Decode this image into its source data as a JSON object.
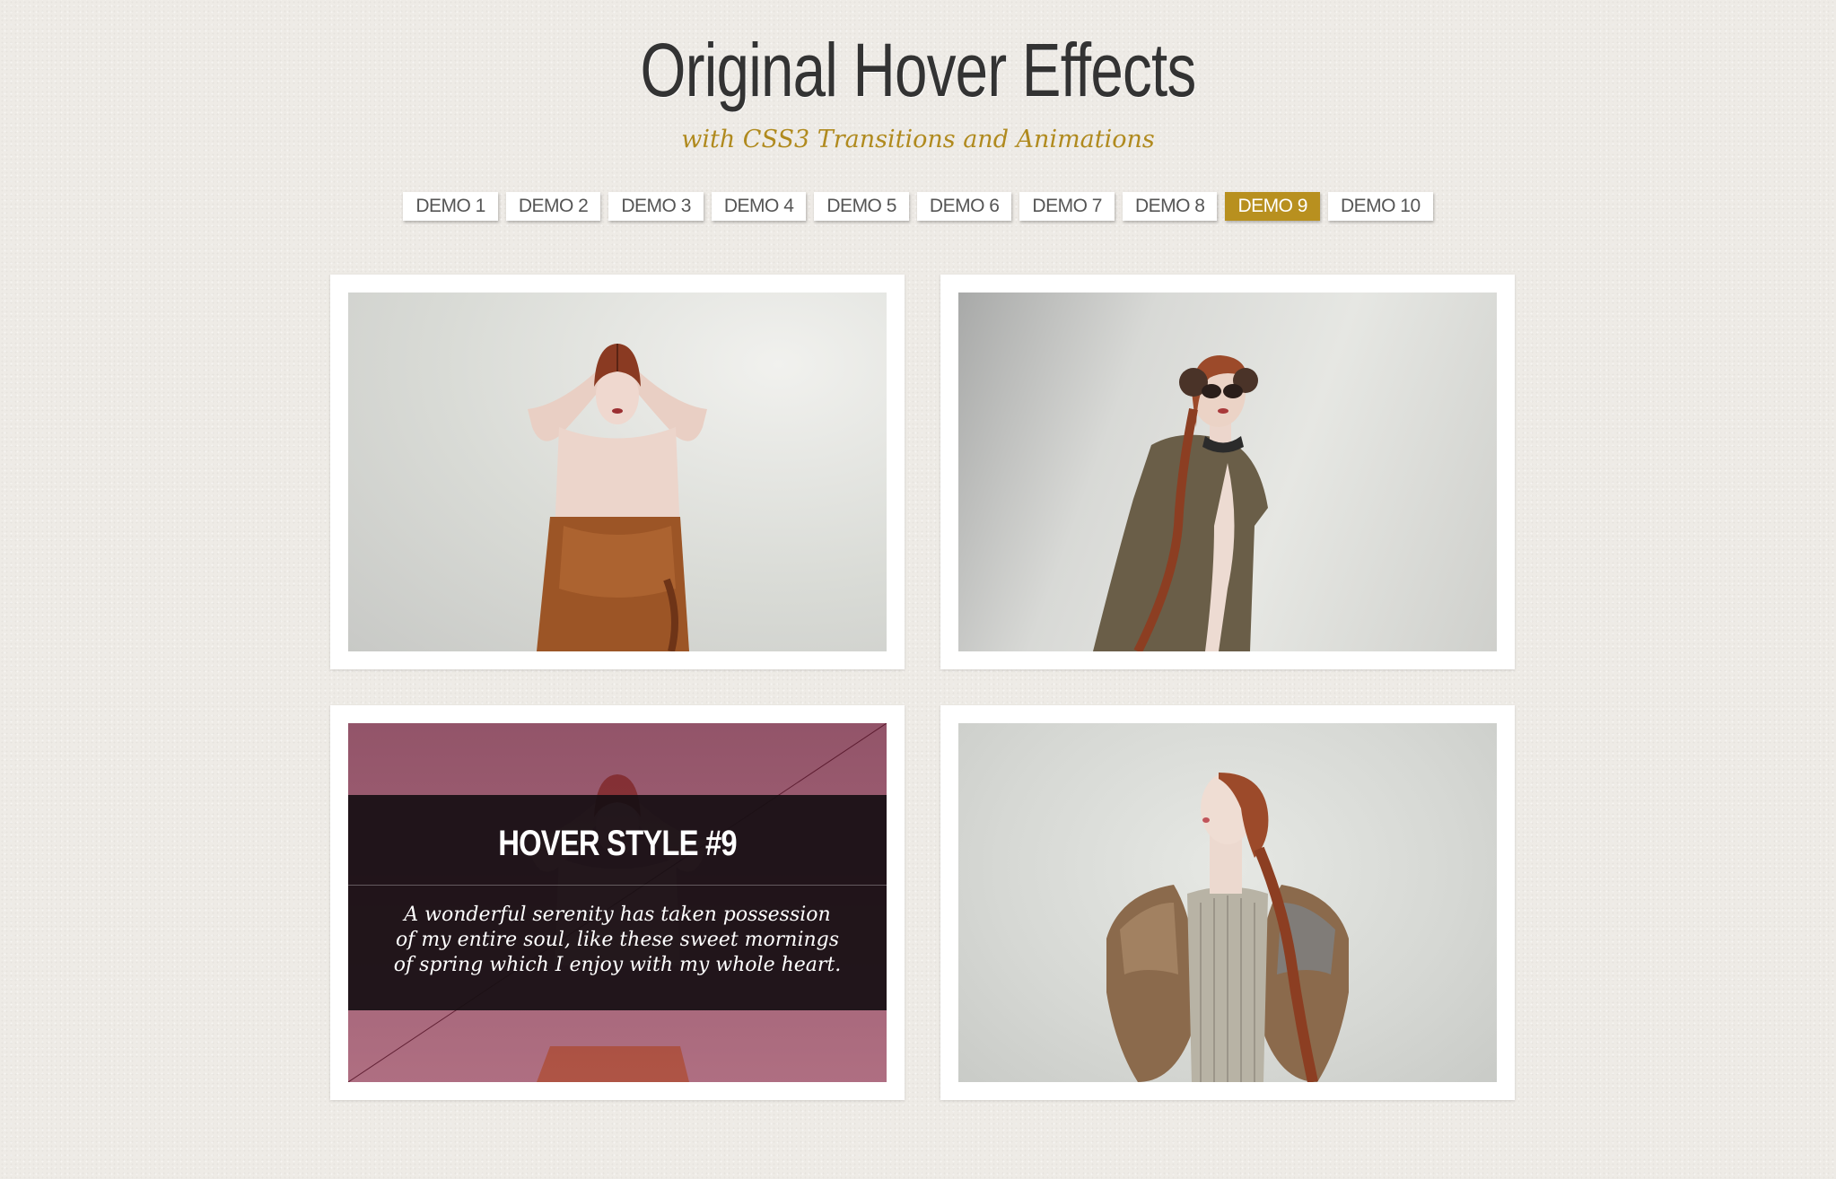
{
  "header": {
    "title": "Original Hover Effects",
    "subtitle": "with CSS3 Transitions and Animations"
  },
  "nav": {
    "items": [
      {
        "label": "DEMO 1",
        "active": false
      },
      {
        "label": "DEMO 2",
        "active": false
      },
      {
        "label": "DEMO 3",
        "active": false
      },
      {
        "label": "DEMO 4",
        "active": false
      },
      {
        "label": "DEMO 5",
        "active": false
      },
      {
        "label": "DEMO 6",
        "active": false
      },
      {
        "label": "DEMO 7",
        "active": false
      },
      {
        "label": "DEMO 8",
        "active": false
      },
      {
        "label": "DEMO 9",
        "active": true
      },
      {
        "label": "DEMO 10",
        "active": false
      }
    ]
  },
  "gallery": {
    "hovered_card": {
      "title": "HOVER STYLE #9",
      "text": "A wonderful serenity has taken possession of my entire soul, like these sweet mornings of spring which I enjoy with my whole heart."
    }
  },
  "colors": {
    "accent": "#b8901f",
    "subtitle": "#b08a1e",
    "background": "#eeebe6",
    "overlay": "#160e12"
  }
}
